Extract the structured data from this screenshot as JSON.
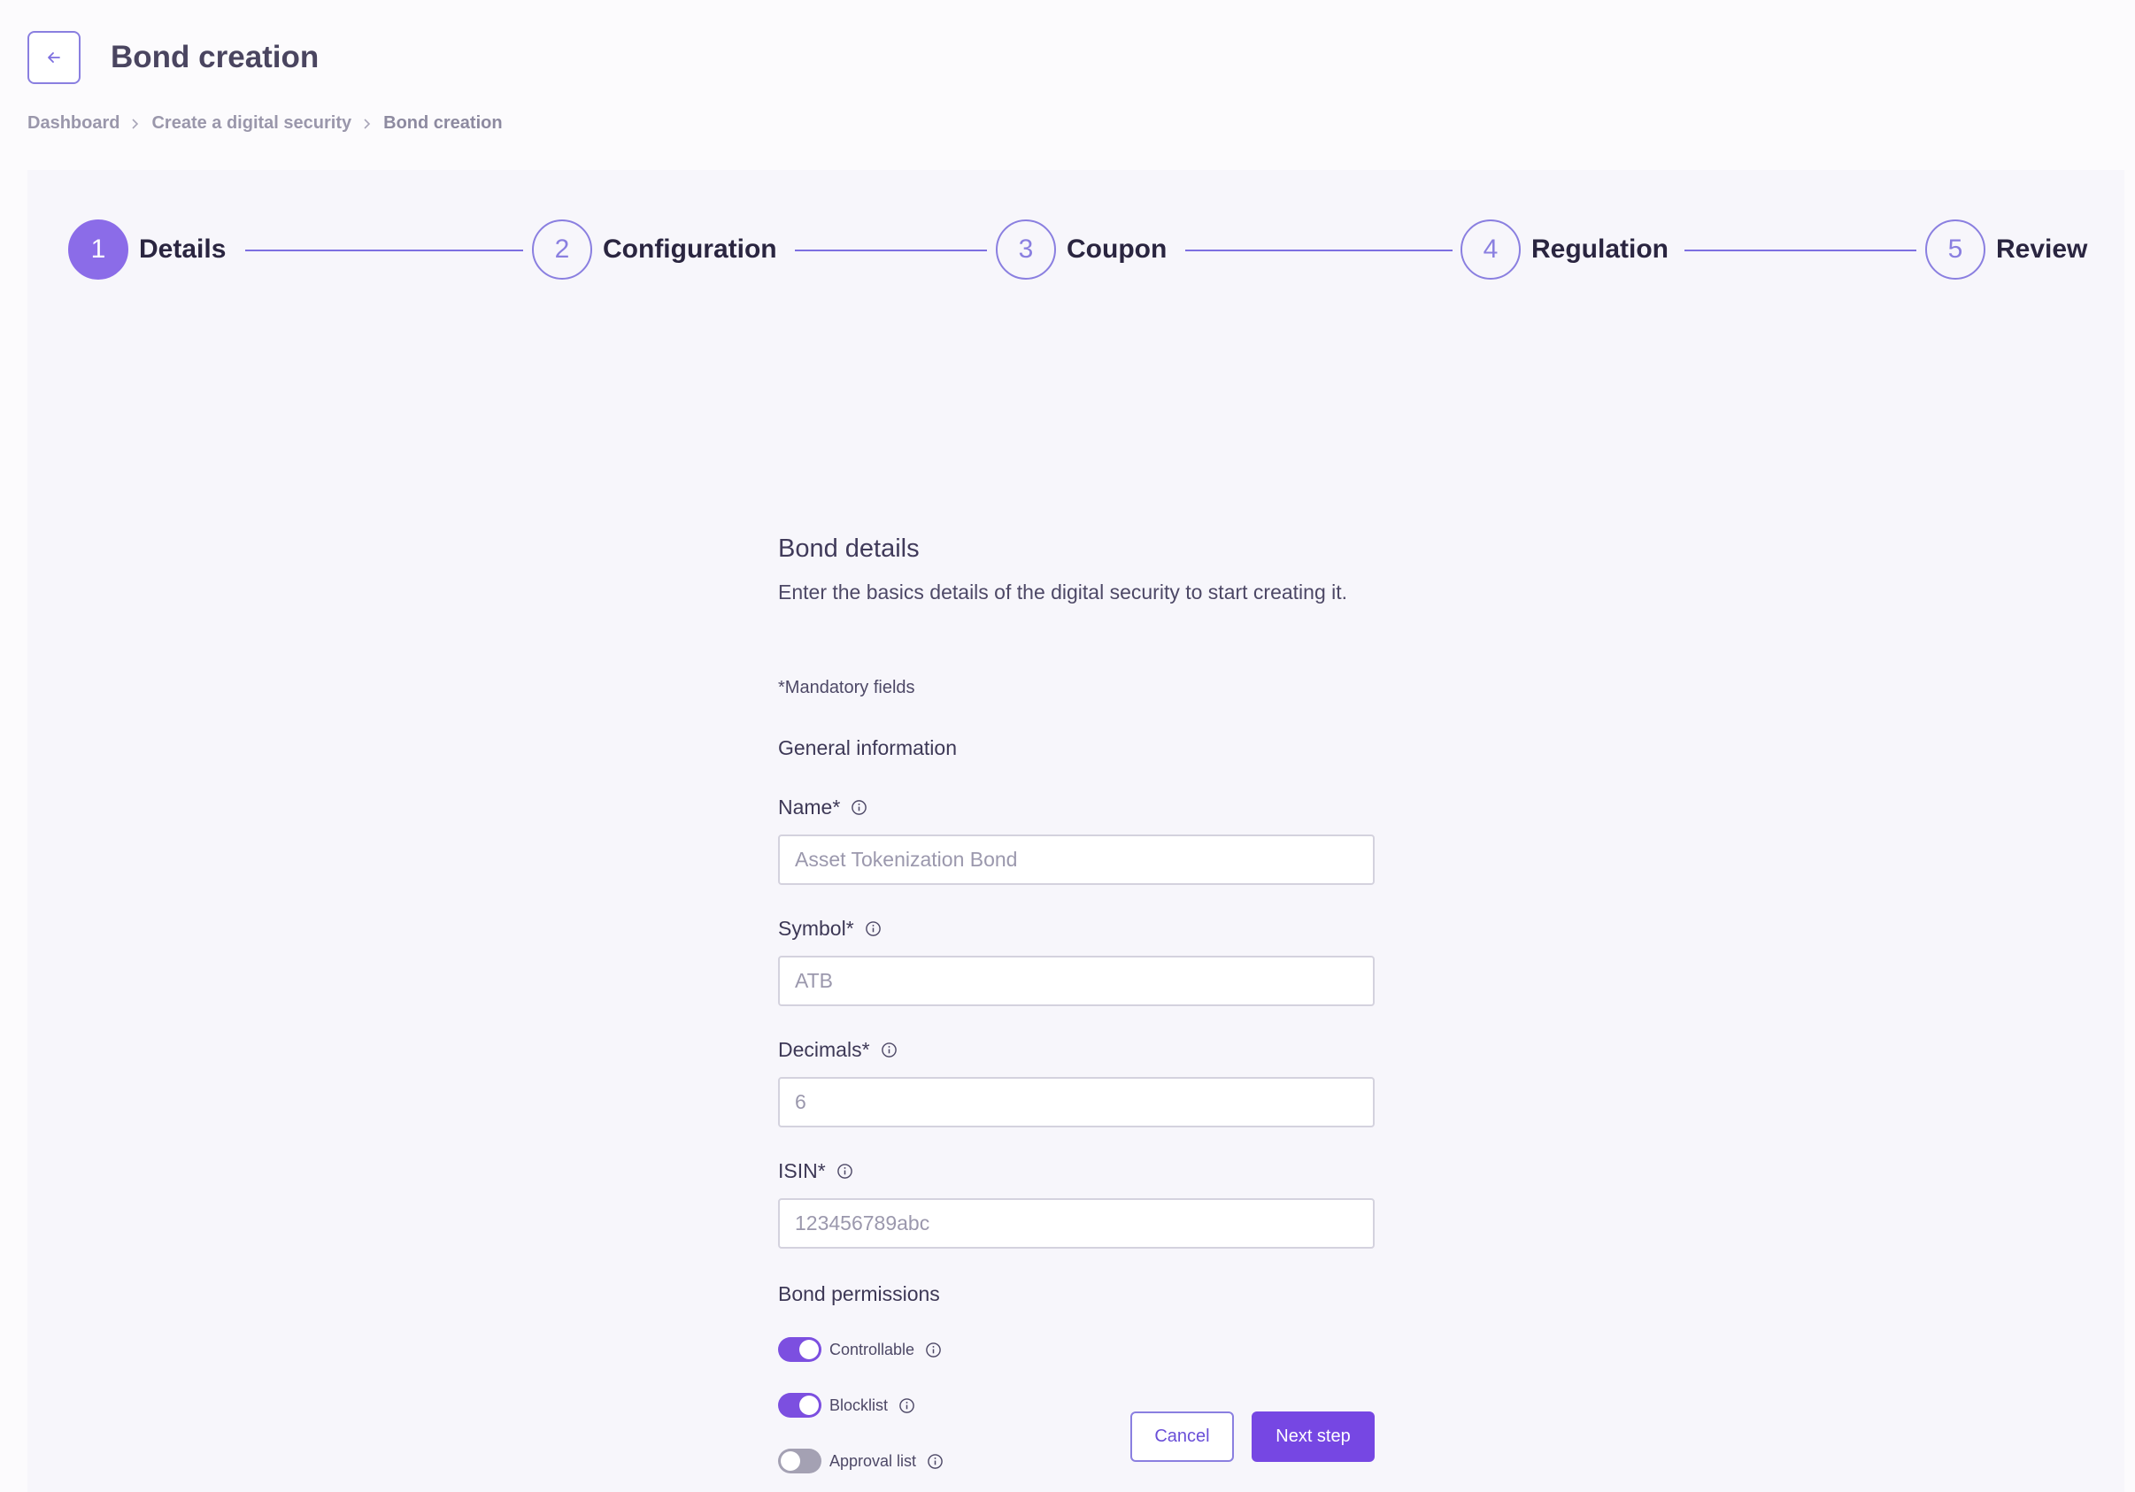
{
  "header": {
    "title": "Bond creation",
    "back_icon": "arrow-left-icon"
  },
  "breadcrumb": [
    {
      "label": "Dashboard"
    },
    {
      "label": "Create a digital security"
    },
    {
      "label": "Bond creation"
    }
  ],
  "stepper": {
    "active_step": 1,
    "steps": [
      {
        "number": "1",
        "label": "Details"
      },
      {
        "number": "2",
        "label": "Configuration"
      },
      {
        "number": "3",
        "label": "Coupon"
      },
      {
        "number": "4",
        "label": "Regulation"
      },
      {
        "number": "5",
        "label": "Review"
      }
    ]
  },
  "form": {
    "title": "Bond details",
    "description": "Enter the basics details of the digital security to start creating it.",
    "mandatory_note": "*Mandatory fields",
    "general_info_title": "General information",
    "fields": {
      "name": {
        "label": "Name*",
        "placeholder": "Asset Tokenization Bond",
        "value": ""
      },
      "symbol": {
        "label": "Symbol*",
        "placeholder": "ATB",
        "value": ""
      },
      "decimals": {
        "label": "Decimals*",
        "placeholder": "6",
        "value": ""
      },
      "isin": {
        "label": "ISIN*",
        "placeholder": "123456789abc",
        "value": ""
      }
    },
    "permissions_title": "Bond permissions",
    "permissions": [
      {
        "label": "Controllable",
        "on": true
      },
      {
        "label": "Blocklist",
        "on": true
      },
      {
        "label": "Approval list",
        "on": false
      }
    ]
  },
  "actions": {
    "cancel_label": "Cancel",
    "next_label": "Next step"
  },
  "colors": {
    "accent": "#7647e3",
    "active_step": "#8b6ce8",
    "toggle_off": "#a4a1b3"
  }
}
